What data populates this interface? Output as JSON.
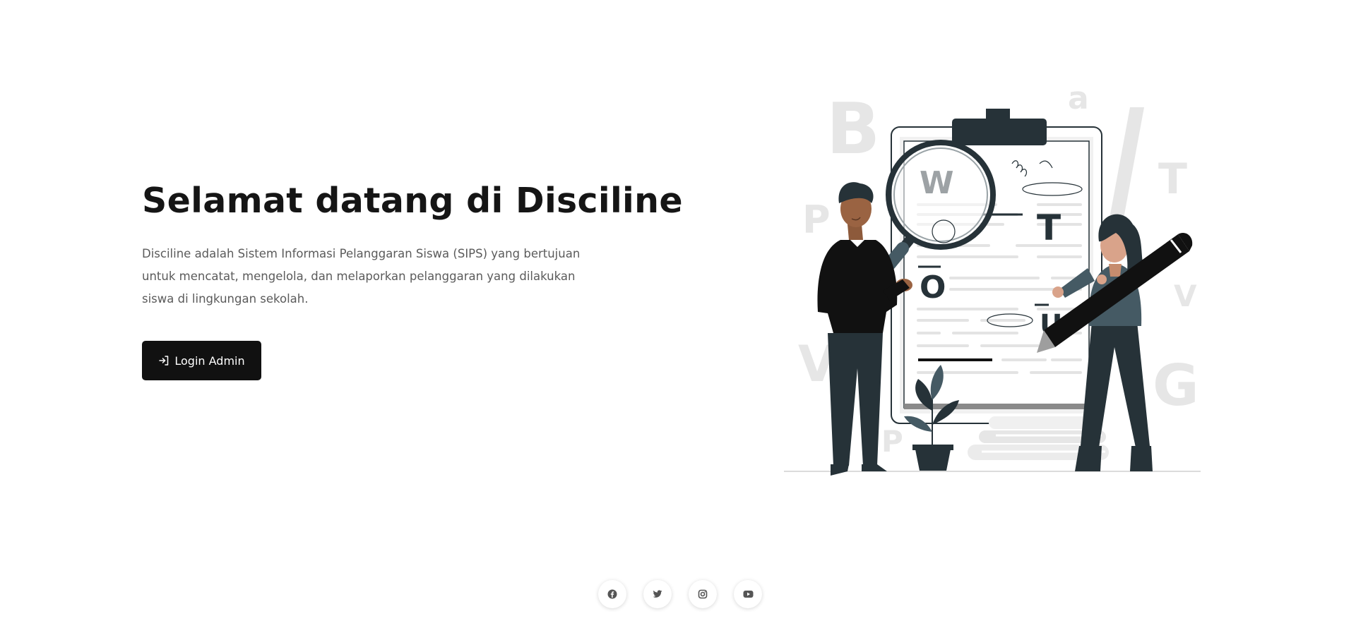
{
  "hero": {
    "title": "Selamat datang di Disciline",
    "description": "Disciline adalah Sistem Informasi Pelanggaran Siswa (SIPS) yang bertujuan untuk mencatat, mengelola, dan melaporkan pelanggaran yang dilakukan siswa di lingkungan sekolah.",
    "login_label": "Login Admin",
    "login_icon": "login-icon"
  },
  "illustration": {
    "letters": {
      "big_b": "B",
      "small_a": "a",
      "big_t": "T",
      "big_p": "P",
      "small_v": "V",
      "big_v": "V",
      "big_g": "G",
      "small_p": "P",
      "board_w": "W",
      "board_t": "T",
      "board_o": "O",
      "board_u": "U"
    }
  },
  "footer": {
    "socials": [
      {
        "icon": "facebook-icon"
      },
      {
        "icon": "twitter-icon"
      },
      {
        "icon": "instagram-icon"
      },
      {
        "icon": "youtube-icon"
      }
    ]
  },
  "colors": {
    "primary": "#111111",
    "heading": "#151515",
    "text": "#5b5b5b",
    "illustration_dark": "#263238",
    "illustration_light": "#e6e6e6"
  }
}
